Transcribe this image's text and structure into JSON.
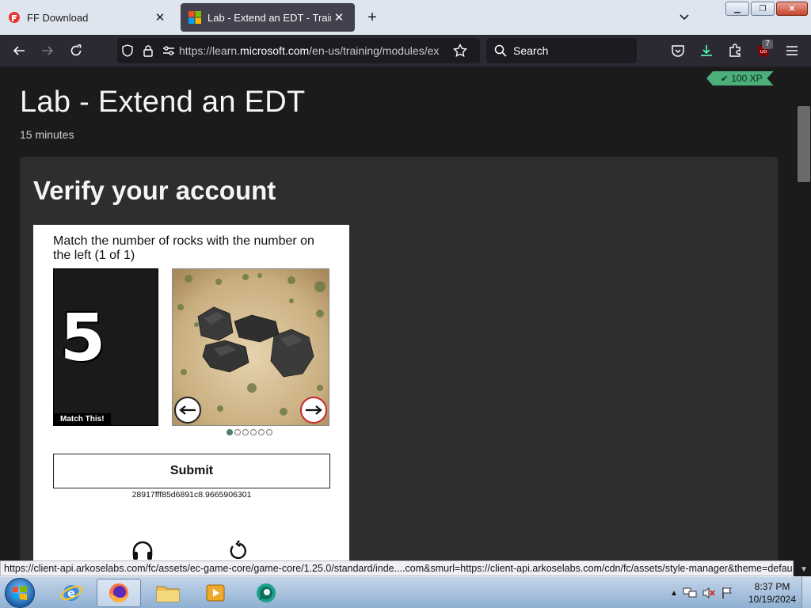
{
  "tabs": [
    {
      "title": "FF Download",
      "active": false
    },
    {
      "title": "Lab - Extend an EDT - Training |",
      "active": true
    }
  ],
  "url": {
    "prefix": "https://learn.",
    "domain": "microsoft.com",
    "path": "/en-us/training/modules/ex"
  },
  "search": {
    "placeholder": "Search"
  },
  "extensions": {
    "badge_count": "7"
  },
  "page": {
    "xp": "100 XP",
    "title": "Lab - Extend an EDT",
    "duration": "15 minutes",
    "verify_heading": "Verify your account"
  },
  "captcha": {
    "instruction": "Match the number of rocks with the number on the left (1 of 1)",
    "target_number": "5",
    "match_label": "Match This!",
    "submit_label": "Submit",
    "session_id": "28917fff85d6891c8.9665906301",
    "dots_total": 6,
    "dots_active": 1
  },
  "status_url": "https://client-api.arkoselabs.com/fc/assets/ec-game-core/game-core/1.25.0/standard/inde....com&smurl=https://client-api.arkoselabs.com/cdn/fc/assets/style-manager&theme=default#",
  "clock": {
    "time": "8:37 PM",
    "date": "10/19/2024"
  },
  "colors": {
    "accent_green": "#4caf7a",
    "browser_dark": "#2b2a33",
    "page_bg": "#1b1b1b"
  }
}
